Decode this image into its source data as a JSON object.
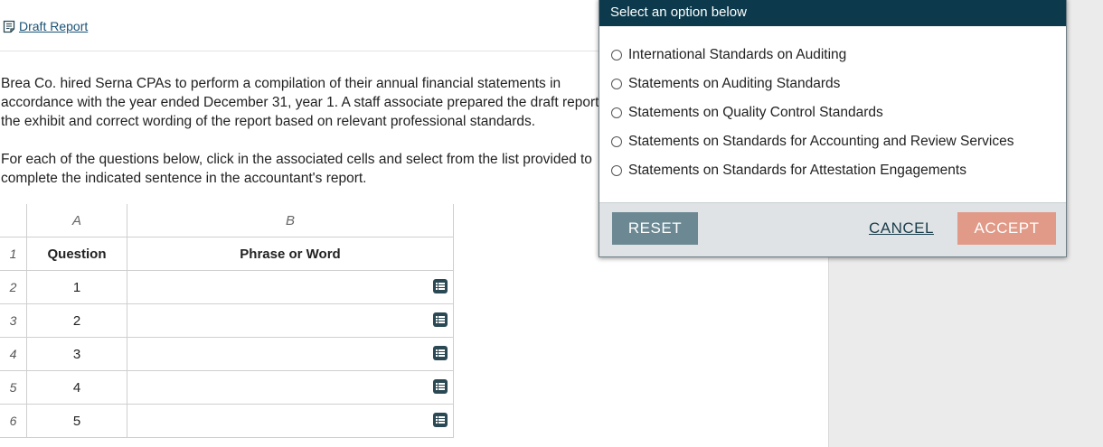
{
  "header": {
    "draft_report_link": "Draft Report"
  },
  "instructions": {
    "paragraph1": "Brea Co. hired Serna CPAs to perform a compilation of their annual financial statements in accordance with the year ended December 31, year 1. A staff associate prepared the draft report in the exhibit and correct wording of the report based on relevant professional standards.",
    "paragraph2": "For each of the questions below, click in the associated cells and select from the list provided to complete the indicated sentence in the accountant's report."
  },
  "grid": {
    "column_letters": [
      "A",
      "B"
    ],
    "header_row": {
      "row_number": "1",
      "question": "Question",
      "phrase": "Phrase or Word"
    },
    "rows": [
      {
        "row_number": "2",
        "question": "1",
        "phrase": ""
      },
      {
        "row_number": "3",
        "question": "2",
        "phrase": ""
      },
      {
        "row_number": "4",
        "question": "3",
        "phrase": ""
      },
      {
        "row_number": "5",
        "question": "4",
        "phrase": ""
      },
      {
        "row_number": "6",
        "question": "5",
        "phrase": ""
      }
    ]
  },
  "popup": {
    "title": "Select an option below",
    "options": [
      "International Standards on Auditing",
      "Statements on Auditing Standards",
      "Statements on Quality Control Standards",
      "Statements on Standards for Accounting and Review Services",
      "Statements on Standards for Attestation Engagements"
    ],
    "reset_label": "RESET",
    "cancel_label": "CANCEL",
    "accept_label": "ACCEPT"
  },
  "colors": {
    "popup_header": "#0c3a4c",
    "reset_button": "#6b8893",
    "accept_button": "#e19a87",
    "link": "#1a5276",
    "cell_icon": "#2b4954"
  },
  "icons": {
    "draft_report": "document-icon",
    "cell_selector": "list-icon"
  }
}
